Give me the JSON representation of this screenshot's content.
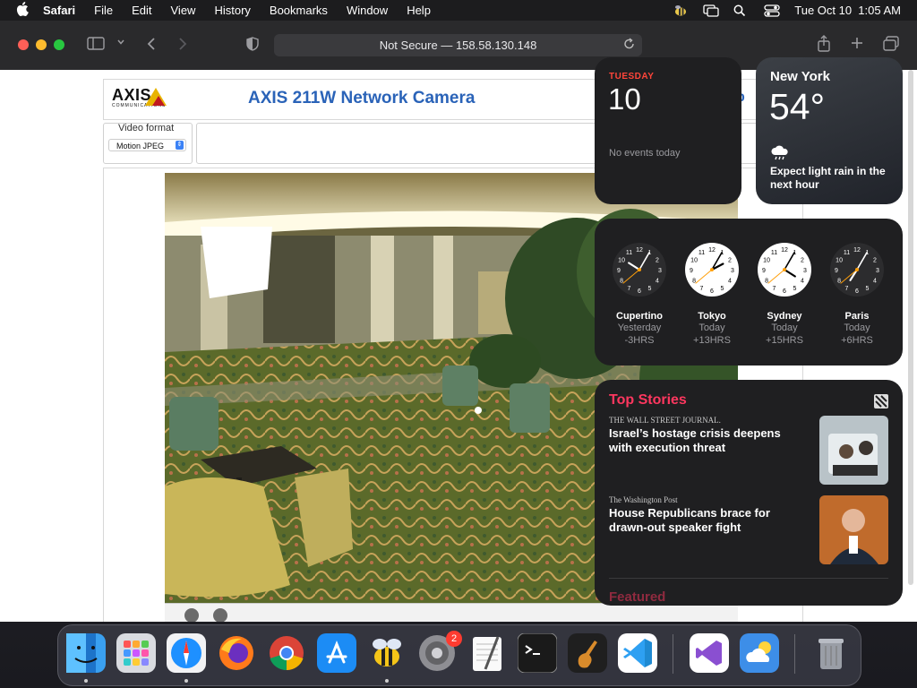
{
  "menubar": {
    "app": "Safari",
    "items": [
      "File",
      "Edit",
      "View",
      "History",
      "Bookmarks",
      "Window",
      "Help"
    ],
    "datetime": "Tue Oct 10  1:05 AM"
  },
  "browser": {
    "url": "Not Secure — 158.58.130.148"
  },
  "axis_page": {
    "logo_text": "AXIS",
    "logo_sub": "COMMUNICATIONS",
    "title": "AXIS 211W Network Camera",
    "partial_link": "p",
    "video_format_label": "Video format",
    "video_format_value": "Motion JPEG"
  },
  "calendar": {
    "weekday": "TUESDAY",
    "day": "10",
    "events": "No events today"
  },
  "weather": {
    "city": "New York",
    "temp": "54°",
    "forecast": "Expect light rain in the next hour"
  },
  "clocks": [
    {
      "city": "Cupertino",
      "day": "Yesterday",
      "offset": "-3HRS",
      "hour": 10.08,
      "minute": 5,
      "dark": true
    },
    {
      "city": "Tokyo",
      "day": "Today",
      "offset": "+13HRS",
      "hour": 2.08,
      "minute": 5,
      "dark": false
    },
    {
      "city": "Sydney",
      "day": "Today",
      "offset": "+15HRS",
      "hour": 4.08,
      "minute": 5,
      "dark": false
    },
    {
      "city": "Paris",
      "day": "Today",
      "offset": "+6HRS",
      "hour": 7.08,
      "minute": 5,
      "dark": true
    }
  ],
  "news": {
    "header": "Top Stories",
    "items": [
      {
        "source": "THE WALL STREET JOURNAL.",
        "headline": "Israel’s hostage crisis deepens with execution threat"
      },
      {
        "source": "The Washington Post",
        "headline": "House Republicans brace for drawn-out speaker fight"
      }
    ],
    "next_section": "Featured"
  },
  "dock": {
    "badge_count": "2",
    "apps": [
      "finder-icon",
      "launchpad-icon",
      "safari-icon",
      "firefox-icon",
      "chrome-icon",
      "app-store-icon",
      "bee-icon",
      "system-settings-icon",
      "textedit-icon",
      "terminal-icon",
      "garageband-icon",
      "vscode-icon",
      "visual-studio-icon",
      "weather-icon",
      "trash-icon"
    ]
  },
  "colors": {
    "accent_red": "#ff453a",
    "news_pink": "#ff375f",
    "axis_blue": "#2a63b8"
  }
}
